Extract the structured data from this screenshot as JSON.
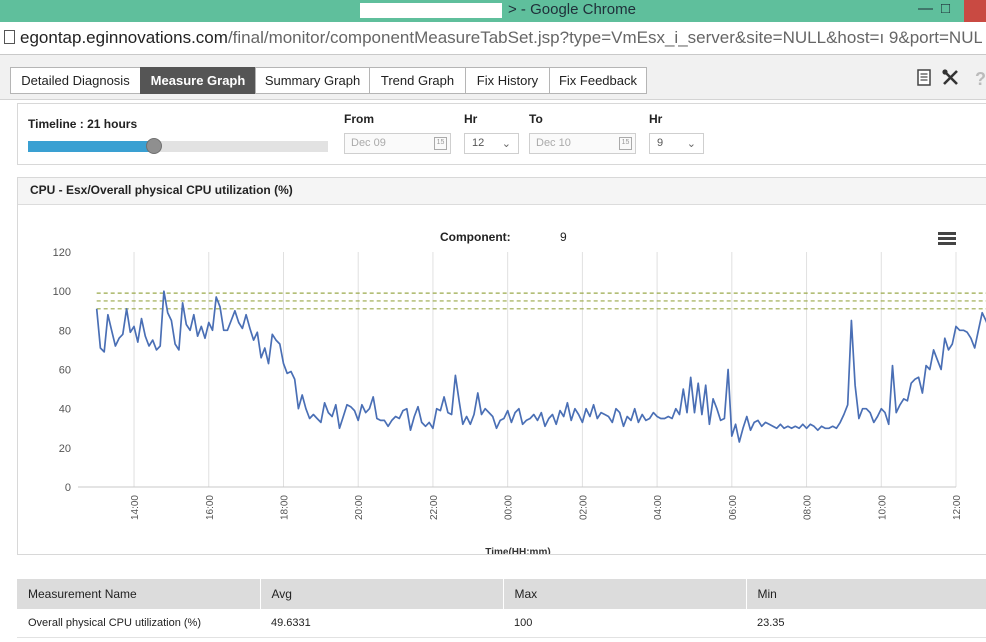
{
  "browser": {
    "title_suffix": "> - Google Chrome",
    "url_host": "egontap.eginnovations.com",
    "url_path": "/final/monitor/componentMeasureTabSet.jsp?type=VmEsx_i_server&site=NULL&host=ı          9&port=NULL&i"
  },
  "tabs": [
    {
      "label": "Detailed Diagnosis",
      "active": false
    },
    {
      "label": "Measure Graph",
      "active": true
    },
    {
      "label": "Summary Graph",
      "active": false
    },
    {
      "label": "Trend Graph",
      "active": false
    },
    {
      "label": "Fix History",
      "active": false
    },
    {
      "label": "Fix Feedback",
      "active": false
    }
  ],
  "toolbar_icons": [
    "document-icon",
    "tools-icon",
    "help-icon"
  ],
  "timeline": {
    "label": "Timeline : 21 hours",
    "slider_fraction": 0.42,
    "from_label": "From",
    "from_date": "Dec 09",
    "from_hr_label": "Hr",
    "from_hr": "12",
    "to_label": "To",
    "to_date": "Dec 10",
    "to_hr_label": "Hr",
    "to_hr": "9",
    "calendar_text": "15"
  },
  "chart_panel": {
    "title": "CPU - Esx/Overall physical CPU utilization (%)"
  },
  "chart_data": {
    "type": "line",
    "subtitle_label": "Component:",
    "subtitle_value": "9",
    "xlabel": "Time(HH:mm)",
    "ylabel": "",
    "xlim": [
      12.5,
      36
    ],
    "ylim": [
      0,
      120
    ],
    "y_ticks": [
      0,
      20,
      40,
      60,
      80,
      100,
      120
    ],
    "x_tick_labels": [
      "14:00",
      "16:00",
      "18:00",
      "20:00",
      "22:00",
      "00:00",
      "02:00",
      "04:00",
      "06:00",
      "08:00",
      "10:00",
      "12:00"
    ],
    "x_tick_hours": [
      14,
      16,
      18,
      20,
      22,
      24,
      26,
      28,
      30,
      32,
      34,
      36
    ],
    "grid": "vertical",
    "line_color": "#4a6fb5",
    "threshold_color": "#9aa84a",
    "thresholds": [
      99,
      95,
      91
    ],
    "series": [
      {
        "values": [
          [
            13.0,
            91
          ],
          [
            13.1,
            71
          ],
          [
            13.2,
            69
          ],
          [
            13.3,
            88
          ],
          [
            13.4,
            80
          ],
          [
            13.5,
            72
          ],
          [
            13.6,
            76
          ],
          [
            13.7,
            78
          ],
          [
            13.8,
            91
          ],
          [
            13.9,
            79
          ],
          [
            14.0,
            82
          ],
          [
            14.1,
            74
          ],
          [
            14.2,
            86
          ],
          [
            14.3,
            77
          ],
          [
            14.4,
            72
          ],
          [
            14.5,
            75
          ],
          [
            14.6,
            70
          ],
          [
            14.7,
            72
          ],
          [
            14.8,
            100
          ],
          [
            14.9,
            89
          ],
          [
            15.0,
            85
          ],
          [
            15.1,
            73
          ],
          [
            15.2,
            70
          ],
          [
            15.3,
            94
          ],
          [
            15.4,
            83
          ],
          [
            15.5,
            80
          ],
          [
            15.6,
            88
          ],
          [
            15.7,
            77
          ],
          [
            15.8,
            82
          ],
          [
            15.9,
            76
          ],
          [
            16.0,
            84
          ],
          [
            16.1,
            80
          ],
          [
            16.2,
            97
          ],
          [
            16.3,
            92
          ],
          [
            16.4,
            80
          ],
          [
            16.5,
            80
          ],
          [
            16.6,
            85
          ],
          [
            16.7,
            90
          ],
          [
            16.8,
            84
          ],
          [
            16.9,
            81
          ],
          [
            17.0,
            88
          ],
          [
            17.1,
            81
          ],
          [
            17.2,
            75
          ],
          [
            17.3,
            79
          ],
          [
            17.4,
            66
          ],
          [
            17.5,
            71
          ],
          [
            17.6,
            63
          ],
          [
            17.7,
            78
          ],
          [
            17.8,
            75
          ],
          [
            17.9,
            73
          ],
          [
            18.0,
            63
          ],
          [
            18.1,
            58
          ],
          [
            18.2,
            59
          ],
          [
            18.3,
            55
          ],
          [
            18.4,
            40
          ],
          [
            18.5,
            47
          ],
          [
            18.6,
            40
          ],
          [
            18.7,
            35
          ],
          [
            18.8,
            37
          ],
          [
            18.9,
            35
          ],
          [
            19.0,
            33
          ],
          [
            19.1,
            43
          ],
          [
            19.2,
            38
          ],
          [
            19.3,
            36
          ],
          [
            19.4,
            42
          ],
          [
            19.5,
            30
          ],
          [
            19.6,
            36
          ],
          [
            19.7,
            42
          ],
          [
            19.8,
            41
          ],
          [
            19.9,
            39
          ],
          [
            20.0,
            34
          ],
          [
            20.1,
            42
          ],
          [
            20.2,
            38
          ],
          [
            20.3,
            40
          ],
          [
            20.4,
            46
          ],
          [
            20.5,
            35
          ],
          [
            20.6,
            34
          ],
          [
            20.7,
            34
          ],
          [
            20.8,
            31
          ],
          [
            20.9,
            34
          ],
          [
            21.0,
            36
          ],
          [
            21.1,
            35
          ],
          [
            21.2,
            39
          ],
          [
            21.3,
            40
          ],
          [
            21.4,
            29
          ],
          [
            21.5,
            36
          ],
          [
            21.6,
            41
          ],
          [
            21.7,
            33
          ],
          [
            21.8,
            31
          ],
          [
            21.9,
            33
          ],
          [
            22.0,
            30
          ],
          [
            22.1,
            40
          ],
          [
            22.2,
            39
          ],
          [
            22.3,
            46
          ],
          [
            22.4,
            38
          ],
          [
            22.5,
            37
          ],
          [
            22.6,
            57
          ],
          [
            22.7,
            44
          ],
          [
            22.8,
            32
          ],
          [
            22.9,
            36
          ],
          [
            23.0,
            32
          ],
          [
            23.1,
            37
          ],
          [
            23.2,
            48
          ],
          [
            23.3,
            37
          ],
          [
            23.4,
            40
          ],
          [
            23.5,
            38
          ],
          [
            23.6,
            36
          ],
          [
            23.7,
            30
          ],
          [
            23.8,
            34
          ],
          [
            23.9,
            35
          ],
          [
            24.0,
            39
          ],
          [
            24.1,
            33
          ],
          [
            24.2,
            38
          ],
          [
            24.3,
            40
          ],
          [
            24.4,
            32
          ],
          [
            24.5,
            34
          ],
          [
            24.6,
            35
          ],
          [
            24.7,
            37
          ],
          [
            24.8,
            34
          ],
          [
            24.9,
            38
          ],
          [
            25.0,
            31
          ],
          [
            25.1,
            35
          ],
          [
            25.2,
            37
          ],
          [
            25.3,
            32
          ],
          [
            25.4,
            39
          ],
          [
            25.5,
            36
          ],
          [
            25.6,
            43
          ],
          [
            25.7,
            34
          ],
          [
            25.8,
            40
          ],
          [
            25.9,
            37
          ],
          [
            26.0,
            33
          ],
          [
            26.1,
            40
          ],
          [
            26.2,
            36
          ],
          [
            26.3,
            42
          ],
          [
            26.4,
            35
          ],
          [
            26.5,
            38
          ],
          [
            26.6,
            37
          ],
          [
            26.7,
            36
          ],
          [
            26.8,
            33
          ],
          [
            26.9,
            40
          ],
          [
            27.0,
            38
          ],
          [
            27.1,
            31
          ],
          [
            27.2,
            36
          ],
          [
            27.3,
            34
          ],
          [
            27.4,
            40
          ],
          [
            27.5,
            33
          ],
          [
            27.6,
            37
          ],
          [
            27.7,
            34
          ],
          [
            27.8,
            35
          ],
          [
            27.9,
            38
          ],
          [
            28.0,
            36
          ],
          [
            28.1,
            35
          ],
          [
            28.2,
            35
          ],
          [
            28.3,
            36
          ],
          [
            28.4,
            35
          ],
          [
            28.5,
            40
          ],
          [
            28.6,
            37
          ],
          [
            28.7,
            50
          ],
          [
            28.8,
            38
          ],
          [
            28.9,
            56
          ],
          [
            29.0,
            38
          ],
          [
            29.1,
            53
          ],
          [
            29.2,
            37
          ],
          [
            29.3,
            52
          ],
          [
            29.4,
            32
          ],
          [
            29.5,
            45
          ],
          [
            29.6,
            40
          ],
          [
            29.7,
            34
          ],
          [
            29.8,
            35
          ],
          [
            29.9,
            60
          ],
          [
            30.0,
            26
          ],
          [
            30.1,
            32
          ],
          [
            30.2,
            23
          ],
          [
            30.3,
            30
          ],
          [
            30.4,
            36
          ],
          [
            30.5,
            29
          ],
          [
            30.6,
            33
          ],
          [
            30.7,
            34
          ],
          [
            30.8,
            31
          ],
          [
            30.9,
            33
          ],
          [
            31.0,
            32
          ],
          [
            31.1,
            31
          ],
          [
            31.2,
            30
          ],
          [
            31.3,
            32
          ],
          [
            31.4,
            30
          ],
          [
            31.5,
            31
          ],
          [
            31.6,
            30
          ],
          [
            31.7,
            31
          ],
          [
            31.8,
            30
          ],
          [
            31.9,
            32
          ],
          [
            32.0,
            30
          ],
          [
            32.1,
            32
          ],
          [
            32.2,
            31
          ],
          [
            32.3,
            29
          ],
          [
            32.4,
            31
          ],
          [
            32.5,
            30
          ],
          [
            32.6,
            30
          ],
          [
            32.7,
            31
          ],
          [
            32.8,
            30
          ],
          [
            32.9,
            33
          ],
          [
            33.0,
            37
          ],
          [
            33.1,
            42
          ],
          [
            33.2,
            85
          ],
          [
            33.3,
            52
          ],
          [
            33.4,
            35
          ],
          [
            33.5,
            40
          ],
          [
            33.6,
            40
          ],
          [
            33.7,
            38
          ],
          [
            33.8,
            33
          ],
          [
            33.9,
            36
          ],
          [
            34.0,
            40
          ],
          [
            34.1,
            38
          ],
          [
            34.2,
            32
          ],
          [
            34.3,
            62
          ],
          [
            34.4,
            38
          ],
          [
            34.5,
            42
          ],
          [
            34.6,
            45
          ],
          [
            34.7,
            44
          ],
          [
            34.8,
            53
          ],
          [
            34.9,
            55
          ],
          [
            35.0,
            56
          ],
          [
            35.1,
            48
          ],
          [
            35.2,
            62
          ],
          [
            35.3,
            60
          ],
          [
            35.4,
            70
          ],
          [
            35.5,
            65
          ],
          [
            35.6,
            60
          ],
          [
            35.7,
            76
          ],
          [
            35.8,
            70
          ],
          [
            35.9,
            73
          ],
          [
            36.0,
            82
          ],
          [
            36.1,
            80
          ],
          [
            36.2,
            80
          ],
          [
            36.3,
            79
          ],
          [
            36.4,
            76
          ],
          [
            36.5,
            71
          ],
          [
            36.6,
            80
          ],
          [
            36.7,
            89
          ],
          [
            36.8,
            85
          ],
          [
            36.9,
            80
          ],
          [
            37.0,
            86
          ],
          [
            37.1,
            85
          ],
          [
            37.2,
            88
          ],
          [
            37.3,
            83
          ]
        ]
      }
    ]
  },
  "table": {
    "headers": [
      "Measurement Name",
      "Avg",
      "Max",
      "Min"
    ],
    "rows": [
      [
        "Overall physical CPU utilization (%)",
        "49.6331",
        "100",
        "23.35"
      ]
    ]
  }
}
